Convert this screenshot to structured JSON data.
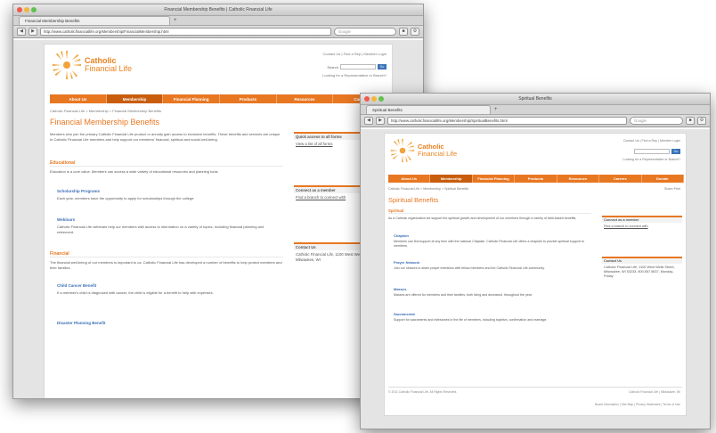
{
  "colors": {
    "brand_orange": "#e87722",
    "link_blue": "#3a6db5",
    "nav_active": "#c85d0e"
  },
  "window_back": {
    "title": "Financial Membership Benefits | Catholic Financial Life",
    "tab": "Financial Membership Benefits",
    "url": "http://www.catholicfinanciallife.org/Membership/FinancialMembership.html",
    "search_placeholder": "Google",
    "page": {
      "logo_line1": "Catholic",
      "logo_line2": "Financial Life",
      "top_links": "Contact Us  |  Find a Rep  |  Member Login",
      "search_label": "Search",
      "search_button": "Go",
      "search_sub": "Looking for a Representative or Branch?",
      "nav": [
        "About Us",
        "Membership",
        "Financial Planning",
        "Products",
        "Resources",
        "Careers"
      ],
      "breadcrumb": "Catholic Financial Life > Membership > Financial Membership Benefits",
      "title": "Financial Membership Benefits",
      "intro": "Members who join the primary Catholic Financial Life product or annuity gain access to exclusive benefits. These benefits and services are unique to Catholic Financial Life members and help support our members' financial, spiritual and social well-being.",
      "sections": [
        {
          "heading": "Educational",
          "body": "Education is a core value. Members can access a wide variety of educational resources and planning tools."
        },
        {
          "subheading": "Scholarship Programs",
          "body": "Each year, members have the opportunity to apply for scholarships through the college."
        },
        {
          "subheading": "Webinars",
          "body": "Catholic Financial Life webinars help our members with access to information on a variety of topics, including financial planning and retirement."
        },
        {
          "heading": "Financial",
          "body": "The financial well-being of our members is important to us. Catholic Financial Life has developed a number of benefits to help protect members and their families."
        },
        {
          "subheading": "Child Cancer Benefit",
          "body": "If a member's child is diagnosed with cancer, the child is eligible for a benefit to help with expenses."
        },
        {
          "subheading": "Disaster Planning Benefit",
          "body": ""
        }
      ],
      "sidebar": [
        {
          "title": "Quick access to all forms",
          "body": "View a list of all forms"
        },
        {
          "title": "Connect as a member",
          "body": "Find a branch to connect with"
        },
        {
          "title": "Contact Us",
          "body": "Catholic Financial Life, 1100 West Wells Street, Milwaukee, WI"
        }
      ]
    }
  },
  "window_front": {
    "title": "Spiritual Benefits",
    "tab": "Spiritual Benefits",
    "url": "http://www.catholicfinanciallife.org/Membership/SpiritualBenefits.html",
    "search_placeholder": "Google",
    "page": {
      "logo_line1": "Catholic",
      "logo_line2": "Financial Life",
      "top_links": "Contact Us  |  Find a Rep  |  Member Login",
      "search_button": "Go",
      "search_sub": "Looking for a Representative or Branch?",
      "nav": [
        "About Us",
        "Membership",
        "Financial Planning",
        "Products",
        "Resources",
        "Careers",
        "Donate"
      ],
      "breadcrumb": "Catholic Financial Life > Membership > Spiritual Benefits",
      "share": "Share  Print",
      "title": "Spiritual Benefits",
      "section": "Spiritual",
      "intro": "As a Catholic organization we support the spiritual growth and development of our members through a variety of faith-based benefits.",
      "items": [
        {
          "heading": "Chaplain",
          "body": "Members can find support at any time with the national Chaplain. Catholic Financial Life offers a chaplain to provide spiritual support to members."
        },
        {
          "heading": "Prayer Network",
          "body": "Join our network to share prayer intentions with fellow members and the Catholic Financial Life community."
        },
        {
          "heading": "Masses",
          "body": "Masses are offered for members and their families, both living and deceased, throughout the year."
        },
        {
          "heading": "Sacramental",
          "body": "Support for sacraments and milestones in the life of members, including baptism, confirmation and marriage."
        }
      ],
      "sidebar": [
        {
          "title": "Connect as a member",
          "body": "Find a branch to connect with"
        },
        {
          "title": "Contact Us",
          "body": "Catholic Financial Life, 1100 West Wells Street, Milwaukee, WI 53233, 800.557.5637, Monday-Friday"
        }
      ],
      "footer_left": "© 2011 Catholic Financial Life. All Rights Reserved.",
      "footer_right": "Catholic Financial Life | Milwaukee, WI",
      "footer_links": "Board Information  |  Site Map  |  Privacy Statement  |  Terms of Use"
    }
  }
}
